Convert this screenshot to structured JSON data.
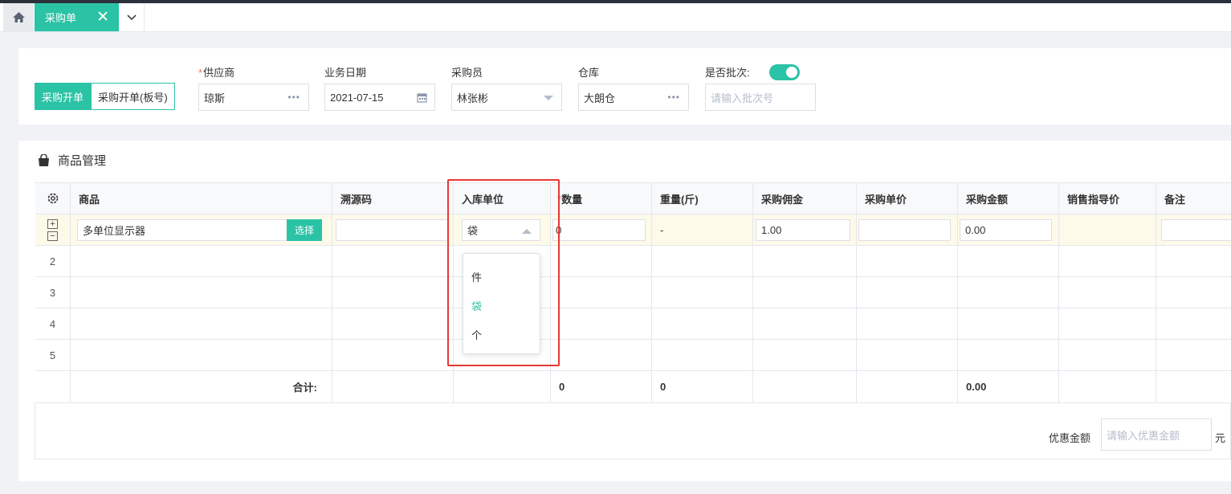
{
  "tabs": {
    "active_label": "采购单",
    "close_glyph": "✕"
  },
  "header": {
    "mode_buttons": [
      "采购开单",
      "采购开单(板号)"
    ],
    "supplier": {
      "label": "供应商",
      "required_mark": "*",
      "value": "琼斯"
    },
    "date": {
      "label": "业务日期",
      "value": "2021-07-15"
    },
    "buyer": {
      "label": "采购员",
      "value": "林张彬"
    },
    "warehouse": {
      "label": "仓库",
      "value": "大朗仓"
    },
    "batch": {
      "label": "是否批次:",
      "placeholder": "请输入批次号",
      "enabled": true
    },
    "dots": "•••"
  },
  "goods": {
    "title": "商品管理",
    "columns": [
      "商品",
      "溯源码",
      "入库单位",
      "数量",
      "重量(斤)",
      "采购佣金",
      "采购单价",
      "采购金额",
      "销售指导价",
      "备注"
    ],
    "required_mark": "*",
    "row1": {
      "plus": "+",
      "minus": "−",
      "product": "多单位显示器",
      "choose_label": "选择",
      "unit": "袋",
      "quantity": "0",
      "weight": "-",
      "commission": "1.00",
      "amount": "0.00"
    },
    "row_numbers": [
      "2",
      "3",
      "4",
      "5"
    ],
    "summary": {
      "label": "合计:",
      "quantity": "0",
      "weight": "0",
      "amount": "0.00"
    },
    "unit_options": [
      "件",
      "袋",
      "个"
    ],
    "unit_selected": "袋"
  },
  "footer": {
    "discount_label": "优惠金额",
    "discount_placeholder": "请输入优惠金额",
    "unit": "元",
    "arrow": "›"
  },
  "colors": {
    "accent": "#2bc3a5",
    "highlight": "#e53935",
    "required": "#f56c6c"
  }
}
